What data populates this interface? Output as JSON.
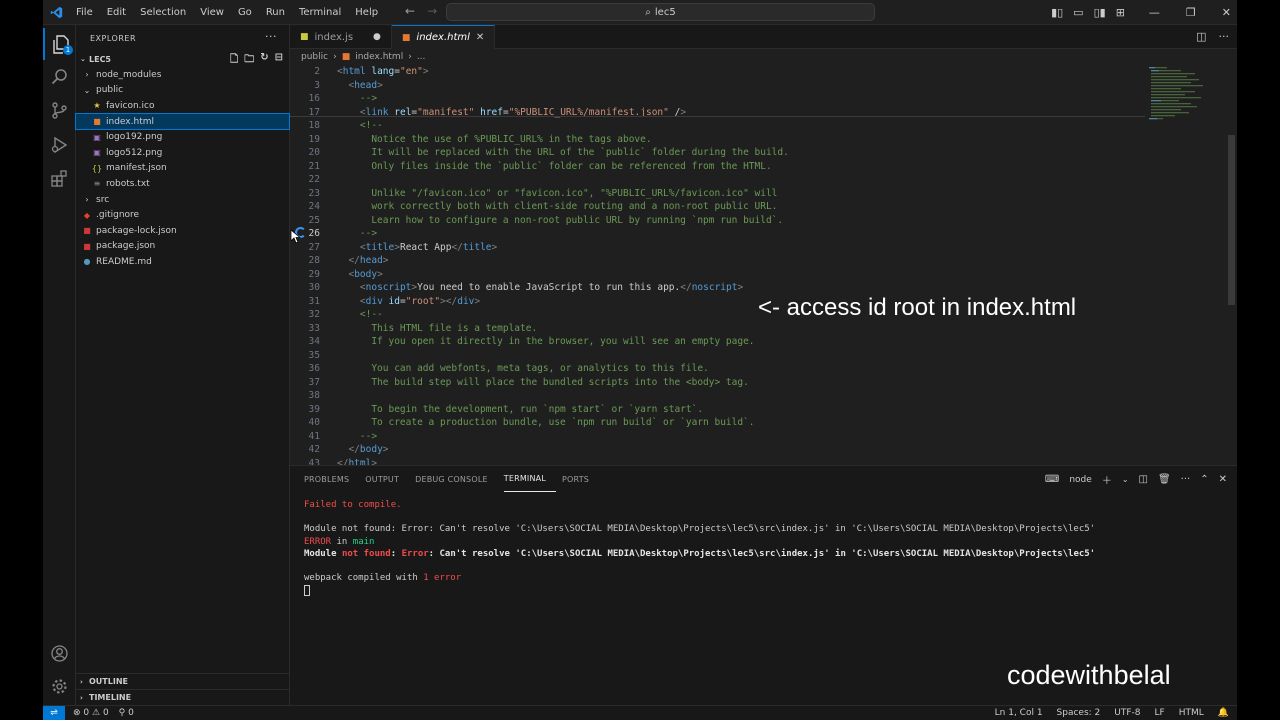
{
  "menu": [
    "File",
    "Edit",
    "Selection",
    "View",
    "Go",
    "Run",
    "Terminal",
    "Help"
  ],
  "search": {
    "text": "lec5"
  },
  "explorer": {
    "title": "EXPLORER",
    "folder": "LEC5",
    "items": [
      {
        "label": "node_modules",
        "icon": "chevron-right",
        "indent": 0
      },
      {
        "label": "public",
        "icon": "chevron-down",
        "indent": 0
      },
      {
        "label": "favicon.ico",
        "icon": "star-icon",
        "indent": 1
      },
      {
        "label": "index.html",
        "icon": "html-icon",
        "indent": 1,
        "selected": true
      },
      {
        "label": "logo192.png",
        "icon": "image-icon",
        "indent": 1
      },
      {
        "label": "logo512.png",
        "icon": "image-icon",
        "indent": 1
      },
      {
        "label": "manifest.json",
        "icon": "json-icon",
        "indent": 1
      },
      {
        "label": "robots.txt",
        "icon": "text-icon",
        "indent": 1
      },
      {
        "label": "src",
        "icon": "chevron-right",
        "indent": 0
      },
      {
        "label": ".gitignore",
        "icon": "git-icon",
        "indent": 0
      },
      {
        "label": "package-lock.json",
        "icon": "npm-icon",
        "indent": 0
      },
      {
        "label": "package.json",
        "icon": "npm-icon",
        "indent": 0
      },
      {
        "label": "README.md",
        "icon": "info-icon",
        "indent": 0
      }
    ],
    "outline": "OUTLINE",
    "timeline": "TIMELINE"
  },
  "tabs": [
    {
      "label": "index.js",
      "active": false,
      "modified": true
    },
    {
      "label": "index.html",
      "active": true,
      "modified": false
    }
  ],
  "breadcrumb": [
    "public",
    "index.html",
    "..."
  ],
  "code_lines": [
    {
      "n": "2",
      "text": "<html lang=\"en\">"
    },
    {
      "n": "3",
      "text": "  <head>"
    },
    {
      "n": "16",
      "text": "    -->"
    },
    {
      "n": "17",
      "text": "    <link rel=\"manifest\" href=\"%PUBLIC_URL%/manifest.json\" />"
    },
    {
      "n": "18",
      "text": "    <!--"
    },
    {
      "n": "19",
      "text": "      Notice the use of %PUBLIC_URL% in the tags above."
    },
    {
      "n": "20",
      "text": "      It will be replaced with the URL of the `public` folder during the build."
    },
    {
      "n": "21",
      "text": "      Only files inside the `public` folder can be referenced from the HTML."
    },
    {
      "n": "22",
      "text": ""
    },
    {
      "n": "23",
      "text": "      Unlike \"/favicon.ico\" or \"favicon.ico\", \"%PUBLIC_URL%/favicon.ico\" will"
    },
    {
      "n": "24",
      "text": "      work correctly both with client-side routing and a non-root public URL."
    },
    {
      "n": "25",
      "text": "      Learn how to configure a non-root public URL by running `npm run build`."
    },
    {
      "n": "26",
      "text": "    -->"
    },
    {
      "n": "27",
      "text": "    <title>React App</title>"
    },
    {
      "n": "28",
      "text": "  </head>"
    },
    {
      "n": "29",
      "text": "  <body>"
    },
    {
      "n": "30",
      "text": "    <noscript>You need to enable JavaScript to run this app.</noscript>"
    },
    {
      "n": "31",
      "text": "    <div id=\"root\"></div>"
    },
    {
      "n": "32",
      "text": "    <!--"
    },
    {
      "n": "33",
      "text": "      This HTML file is a template."
    },
    {
      "n": "34",
      "text": "      If you open it directly in the browser, you will see an empty page."
    },
    {
      "n": "35",
      "text": ""
    },
    {
      "n": "36",
      "text": "      You can add webfonts, meta tags, or analytics to this file."
    },
    {
      "n": "37",
      "text": "      The build step will place the bundled scripts into the <body> tag."
    },
    {
      "n": "38",
      "text": ""
    },
    {
      "n": "39",
      "text": "      To begin the development, run `npm start` or `yarn start`."
    },
    {
      "n": "40",
      "text": "      To create a production bundle, use `npm run build` or `yarn build`."
    },
    {
      "n": "41",
      "text": "    -->"
    },
    {
      "n": "42",
      "text": "  </body>"
    },
    {
      "n": "43",
      "text": "</html>"
    }
  ],
  "overlay_note": "<- access id root in index.html",
  "panel": {
    "tabs": [
      "PROBLEMS",
      "OUTPUT",
      "DEBUG CONSOLE",
      "TERMINAL",
      "PORTS"
    ],
    "active_tab": "TERMINAL",
    "terminal_name": "node",
    "lines": {
      "failed": "Failed to compile.",
      "module_err": "Module not found: Error: Can't resolve 'C:\\Users\\SOCIAL MEDIA\\Desktop\\Projects\\lec5\\src\\index.js' in 'C:\\Users\\SOCIAL MEDIA\\Desktop\\Projects\\lec5'",
      "error_word": "ERROR",
      "in_word": " in ",
      "main_word": "main",
      "module_word": "Module ",
      "not_found": "not found",
      "colon": ": ",
      "error_word2": "Error",
      "rest": ": Can't resolve 'C:\\Users\\SOCIAL MEDIA\\Desktop\\Projects\\lec5\\src\\index.js' in 'C:\\Users\\SOCIAL MEDIA\\Desktop\\Projects\\lec5'",
      "webpack": "webpack compiled with ",
      "one_error": "1 error"
    }
  },
  "status": {
    "problems": "0",
    "warnings": "0",
    "ports": "0",
    "position": "Ln 1, Col 1",
    "spaces": "Spaces: 2",
    "encoding": "UTF-8",
    "eol": "LF",
    "language": "HTML"
  },
  "watermark": "codewithbelal",
  "colors": {
    "accent": "#0078d4",
    "error": "#f14c4c",
    "green": "#23d18b"
  }
}
